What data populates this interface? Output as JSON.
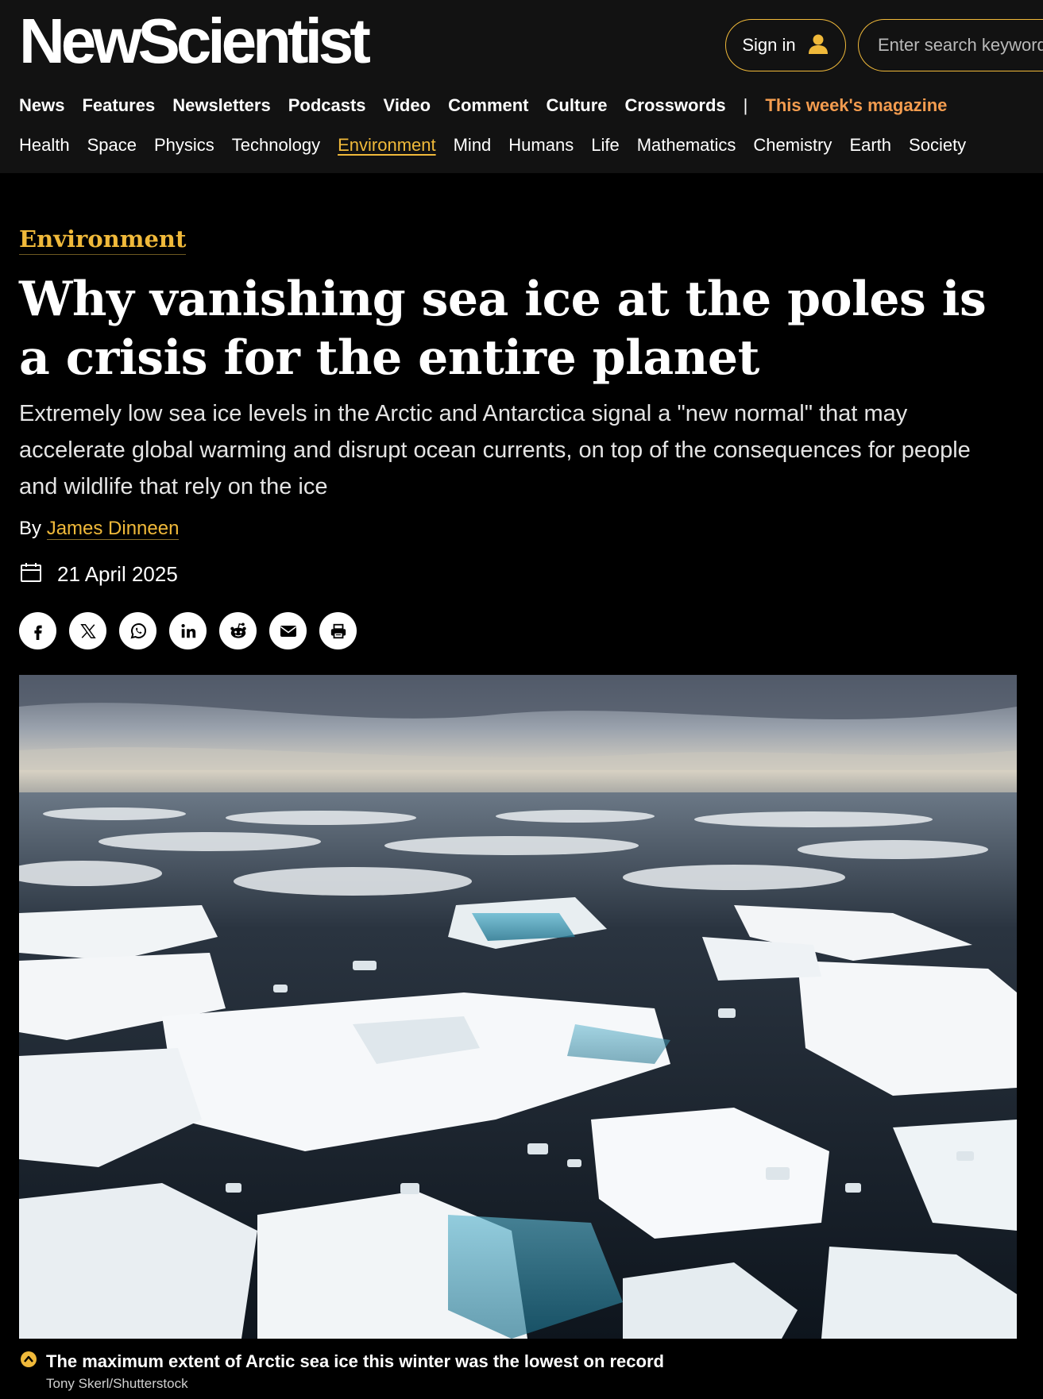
{
  "brand": {
    "logo": "NewScientist"
  },
  "header": {
    "sign_in_label": "Sign in",
    "search_placeholder": "Enter search keywords"
  },
  "primary_nav": {
    "news": "News",
    "features": "Features",
    "newsletters": "Newsletters",
    "podcasts": "Podcasts",
    "video": "Video",
    "comment": "Comment",
    "culture": "Culture",
    "crosswords": "Crosswords",
    "separator": "|",
    "magazine": "This week's magazine"
  },
  "secondary_nav": {
    "health": "Health",
    "space": "Space",
    "physics": "Physics",
    "technology": "Technology",
    "environment": "Environment",
    "mind": "Mind",
    "humans": "Humans",
    "life": "Life",
    "mathematics": "Mathematics",
    "chemistry": "Chemistry",
    "earth": "Earth",
    "society": "Society",
    "active": "Environment"
  },
  "article": {
    "section": "Environment",
    "headline": "Why vanishing sea ice at the poles is a crisis for the entire planet",
    "standfirst": "Extremely low sea ice levels in the Arctic and Antarctica signal a \"new normal\" that may accelerate global warming and disrupt ocean currents, on top of the consequences for people and wildlife that rely on the ice",
    "byline_prefix": "By",
    "author": "James Dinneen",
    "date": "21 April 2025"
  },
  "share_icons": [
    "facebook-icon",
    "x-icon",
    "whatsapp-icon",
    "linkedin-icon",
    "reddit-icon",
    "email-icon",
    "print-icon"
  ],
  "hero_image": {
    "caption": "The maximum extent of Arctic sea ice this winter was the lowest on record",
    "credit": "Tony Skerl/Shutterstock"
  },
  "colors": {
    "accent_gold": "#f0b93a",
    "magazine_orange": "#f39c4f",
    "header_bg": "#121212",
    "page_bg": "#000000"
  }
}
